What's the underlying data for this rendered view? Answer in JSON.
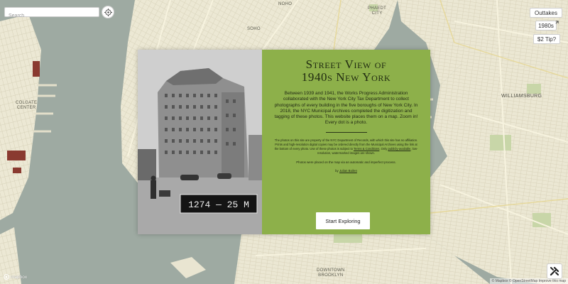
{
  "search": {
    "placeholder": "Search"
  },
  "buttons": {
    "outtakes": "Outtakes",
    "year": "1980s",
    "tip": "$2 Tip?"
  },
  "map_labels": {
    "noho": "NOHO",
    "phaedt_city": "PHAEDT\nCITY",
    "soho": "SOHO",
    "colgate_center": "COLGATE\nCENTER",
    "williamsburg": "WILLIAMSBURG",
    "downtown_brooklyn": "DOWNTOWN\nBROOKLYN"
  },
  "modal": {
    "title_line1": "Street View of",
    "title_line2": "1940s New York",
    "lead": "Between 1939 and 1941, the Works Progress Administration collaborated with the New York City Tax Department to collect photographs of every building in the five boroughs of New York City. In 2018, the NYC Municipal Archives completed the digitization and tagging of these photos. This website places them on a map. Zoom in! Every dot is a photo.",
    "fine_print_a": "The photos on this site are property of the NYC Department of Records, with which this site has no affiliation. Prints and high-resolution digital copies may be ordered directly from the Municipal Archives using the link at the bottom of every photo. Use of these photos is subject to",
    "terms_link": "Terms & Conditions",
    "fine_print_b": ". Only",
    "public_link": "publicly-available",
    "fine_print_c": ", low-resolution, watermarked images are shown.",
    "placement_note": "Photos were placed on the map via an automatic and imperfect process.",
    "by_prefix": "by",
    "author": "Julian Boilen",
    "start_button": "Start Exploring",
    "photo_plate": "1274 — 25   M"
  },
  "footer": {
    "mapbox": "mapbox",
    "attribution": "© Mapbox  © OpenStreetMap  Improve this map"
  },
  "icons": {
    "locate": "crosshair-icon",
    "external": "external-link-icon",
    "tool": "tools-icon"
  },
  "colors": {
    "water": "#9eaaa2",
    "land": "#ece9d9",
    "panel": "#8db04a",
    "park": "#c8d6a8"
  }
}
